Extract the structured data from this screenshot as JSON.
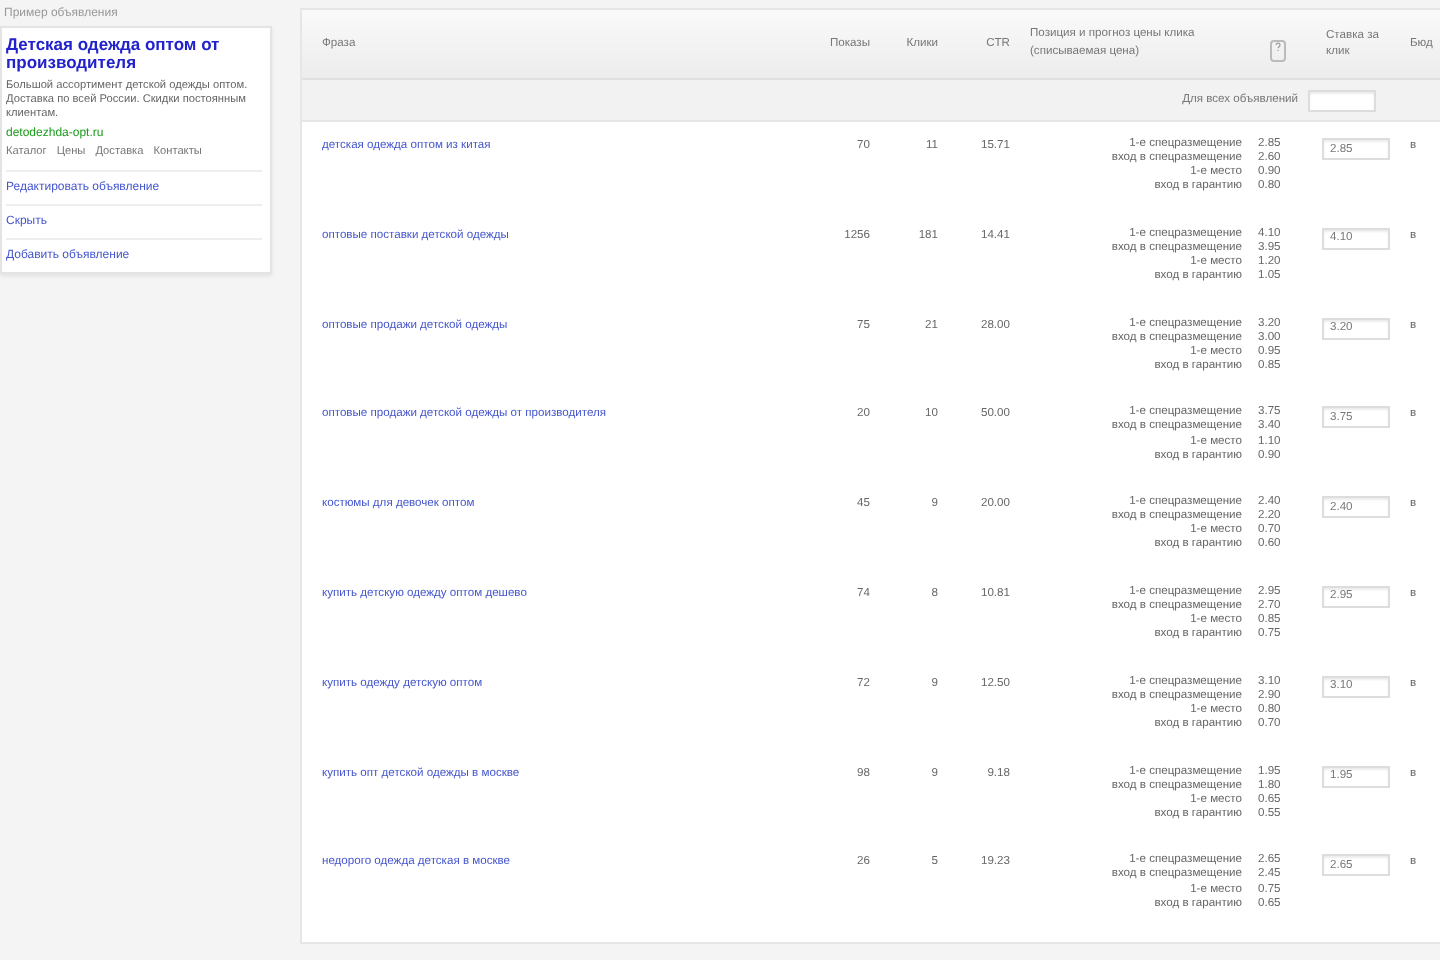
{
  "ad_preview": {
    "caption": "Пример объявления",
    "title": "Детская одежда оптом от производителя",
    "text": "Большой ассортимент детской одежды оптом. Доставка по всей России. Скидки постоянным клиентам.",
    "url": "detodezhda-opt.ru",
    "sitelinks": [
      "Каталог",
      "Цены",
      "Доставка",
      "Контакты"
    ],
    "links": [
      {
        "label": "Редактировать объявление"
      },
      {
        "label": "Скрыть"
      },
      {
        "label": "Добавить объявление"
      }
    ]
  },
  "table": {
    "columns": [
      "Фраза",
      "Показы",
      "Клики",
      "CTR",
      "Позиция и прогноз цены клика (списываемая цена)",
      "Ставка за клик",
      "Бюд"
    ],
    "filter": {
      "label": "Для всех объявлений"
    },
    "rows": [
      {
        "phrase": "детская одежда оптом из китая",
        "shows": "70",
        "clicks": "11",
        "ctr": "15.71",
        "positions": [
          {
            "label": "1-е спецразмещение",
            "price": "2.85"
          },
          {
            "label": "вход в спецразмещение",
            "price": "2.60"
          },
          {
            "label": "1-е место",
            "price": "0.90"
          },
          {
            "label": "вход в гарантию",
            "price": "0.80"
          }
        ],
        "bid": "2.85",
        "column_8": "в"
      },
      {
        "phrase": "оптовые поставки детской одежды",
        "shows": "1256",
        "clicks": "181",
        "ctr": "14.41",
        "positions": [
          {
            "label": "1-е спецразмещение",
            "price": "4.10"
          },
          {
            "label": "вход в спецразмещение",
            "price": "3.95"
          },
          {
            "label": "1-е место",
            "price": "1.20"
          },
          {
            "label": "вход в гарантию",
            "price": "1.05"
          }
        ],
        "bid": "4.10",
        "column_8": "в"
      },
      {
        "phrase": "оптовые продажи детской одежды",
        "shows": "75",
        "clicks": "21",
        "ctr": "28.00",
        "positions": [
          {
            "label": "1-е спецразмещение",
            "price": "3.20"
          },
          {
            "label": "вход в спецразмещение",
            "price": "3.00"
          },
          {
            "label": "1-е место",
            "price": "0.95"
          },
          {
            "label": "вход в гарантию",
            "price": "0.85"
          }
        ],
        "bid": "3.20",
        "column_8": "в"
      },
      {
        "phrase": "оптовые продажи детской одежды от производителя",
        "shows": "20",
        "clicks": "10",
        "ctr": "50.00",
        "positions": [
          {
            "label": "1-е спецразмещение",
            "price": "3.75"
          },
          {
            "label": "вход в спецразмещение",
            "price": "3.40"
          },
          {
            "label": "1-е место",
            "price": "1.10"
          },
          {
            "label": "вход в гарантию",
            "price": "0.90"
          }
        ],
        "bid": "3.75",
        "column_8": "в"
      },
      {
        "phrase": "костюмы для девочек оптом",
        "shows": "45",
        "clicks": "9",
        "ctr": "20.00",
        "positions": [
          {
            "label": "1-е спецразмещение",
            "price": "2.40"
          },
          {
            "label": "вход в спецразмещение",
            "price": "2.20"
          },
          {
            "label": "1-е место",
            "price": "0.70"
          },
          {
            "label": "вход в гарантию",
            "price": "0.60"
          }
        ],
        "bid": "2.40",
        "column_8": "в"
      },
      {
        "phrase": "купить детскую одежду оптом дешево",
        "shows": "74",
        "clicks": "8",
        "ctr": "10.81",
        "positions": [
          {
            "label": "1-е спецразмещение",
            "price": "2.95"
          },
          {
            "label": "вход в спецразмещение",
            "price": "2.70"
          },
          {
            "label": "1-е место",
            "price": "0.85"
          },
          {
            "label": "вход в гарантию",
            "price": "0.75"
          }
        ],
        "bid": "2.95",
        "column_8": "в"
      },
      {
        "phrase": "купить одежду детскую оптом",
        "shows": "72",
        "clicks": "9",
        "ctr": "12.50",
        "positions": [
          {
            "label": "1-е спецразмещение",
            "price": "3.10"
          },
          {
            "label": "вход в спецразмещение",
            "price": "2.90"
          },
          {
            "label": "1-е место",
            "price": "0.80"
          },
          {
            "label": "вход в гарантию",
            "price": "0.70"
          }
        ],
        "bid": "3.10",
        "column_8": "в"
      },
      {
        "phrase": "купить опт детской одежды в москве",
        "shows": "98",
        "clicks": "9",
        "ctr": "9.18",
        "positions": [
          {
            "label": "1-е спецразмещение",
            "price": "1.95"
          },
          {
            "label": "вход в спецразмещение",
            "price": "1.80"
          },
          {
            "label": "1-е место",
            "price": "0.65"
          },
          {
            "label": "вход в гарантию",
            "price": "0.55"
          }
        ],
        "bid": "1.95",
        "column_8": "в"
      },
      {
        "phrase": "недорого одежда детская в москве",
        "shows": "26",
        "clicks": "5",
        "ctr": "19.23",
        "positions": [
          {
            "label": "1-е спецразмещение",
            "price": "2.65"
          },
          {
            "label": "вход в спецразмещение",
            "price": "2.45"
          },
          {
            "label": "1-е место",
            "price": "0.75"
          },
          {
            "label": "вход в гарантию",
            "price": "0.65"
          }
        ],
        "bid": "2.65",
        "column_8": "в"
      }
    ]
  }
}
